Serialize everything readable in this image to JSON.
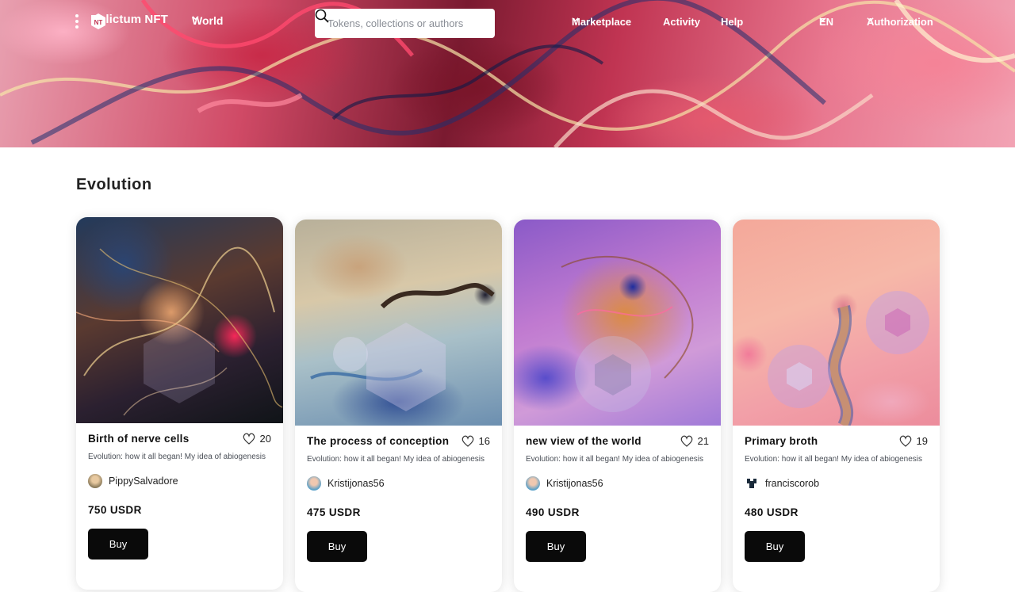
{
  "header": {
    "brand_name": "Relictum NFT",
    "network_label": "World",
    "search_placeholder": "Tokens, collections or authors",
    "nav": {
      "marketplace": "Marketplace",
      "activity": "Activity",
      "help": "Help",
      "language": "EN",
      "authorization": "Authorization"
    },
    "icons": [
      "menu-dots-icon",
      "logo-icon",
      "chevron-down-icon",
      "search-icon"
    ]
  },
  "section": {
    "title": "Evolution"
  },
  "cards": [
    {
      "title": "Birth of nerve cells",
      "likes": "20",
      "description": "Evolution: how it all began! My idea of abiogenesis",
      "author": "PippySalvadore",
      "price": "750 USDR",
      "buy_label": "Buy"
    },
    {
      "title": "The process of conception",
      "likes": "16",
      "description": "Evolution: how it all began! My idea of abiogenesis",
      "author": "Kristijonas56",
      "price": "475 USDR",
      "buy_label": "Buy"
    },
    {
      "title": "new view of the world",
      "likes": "21",
      "description": "Evolution: how it all began! My idea of abiogenesis",
      "author": "Kristijonas56",
      "price": "490 USDR",
      "buy_label": "Buy"
    },
    {
      "title": "Primary broth",
      "likes": "19",
      "description": "Evolution: how it all began! My idea of abiogenesis",
      "author": "franciscorob",
      "price": "480 USDR",
      "buy_label": "Buy"
    }
  ],
  "colors": {
    "button_bg": "#0a0a0a",
    "text_primary": "#111111",
    "text_secondary": "#4a4f57"
  }
}
